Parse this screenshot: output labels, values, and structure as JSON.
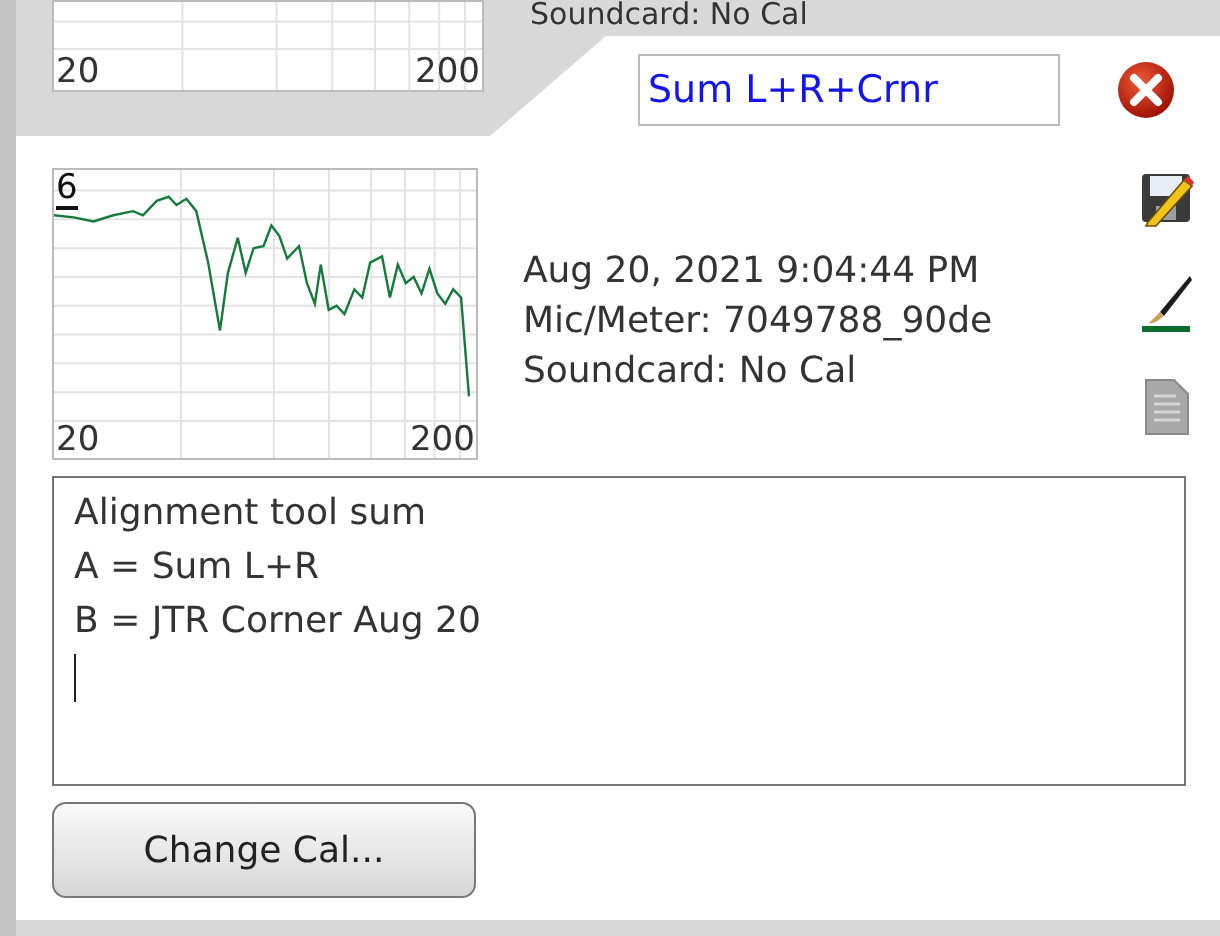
{
  "back_card": {
    "chart_axis": {
      "x_min": "20",
      "x_max": "200"
    },
    "soundcard": "Soundcard: No Cal"
  },
  "front_card": {
    "name_field": {
      "value": "Sum L+R+Crnr"
    },
    "chart": {
      "y_label": "6",
      "x_min": "20",
      "x_max": "200"
    },
    "info": [
      "Aug 20, 2021 9:04:44 PM",
      "Mic/Meter: 7049788_90de",
      "Soundcard: No Cal"
    ],
    "notes": {
      "value": "Alignment tool sum\nA = Sum L+R\nB = JTR Corner Aug 20\n"
    },
    "buttons": [
      "Change Cal..."
    ]
  }
}
